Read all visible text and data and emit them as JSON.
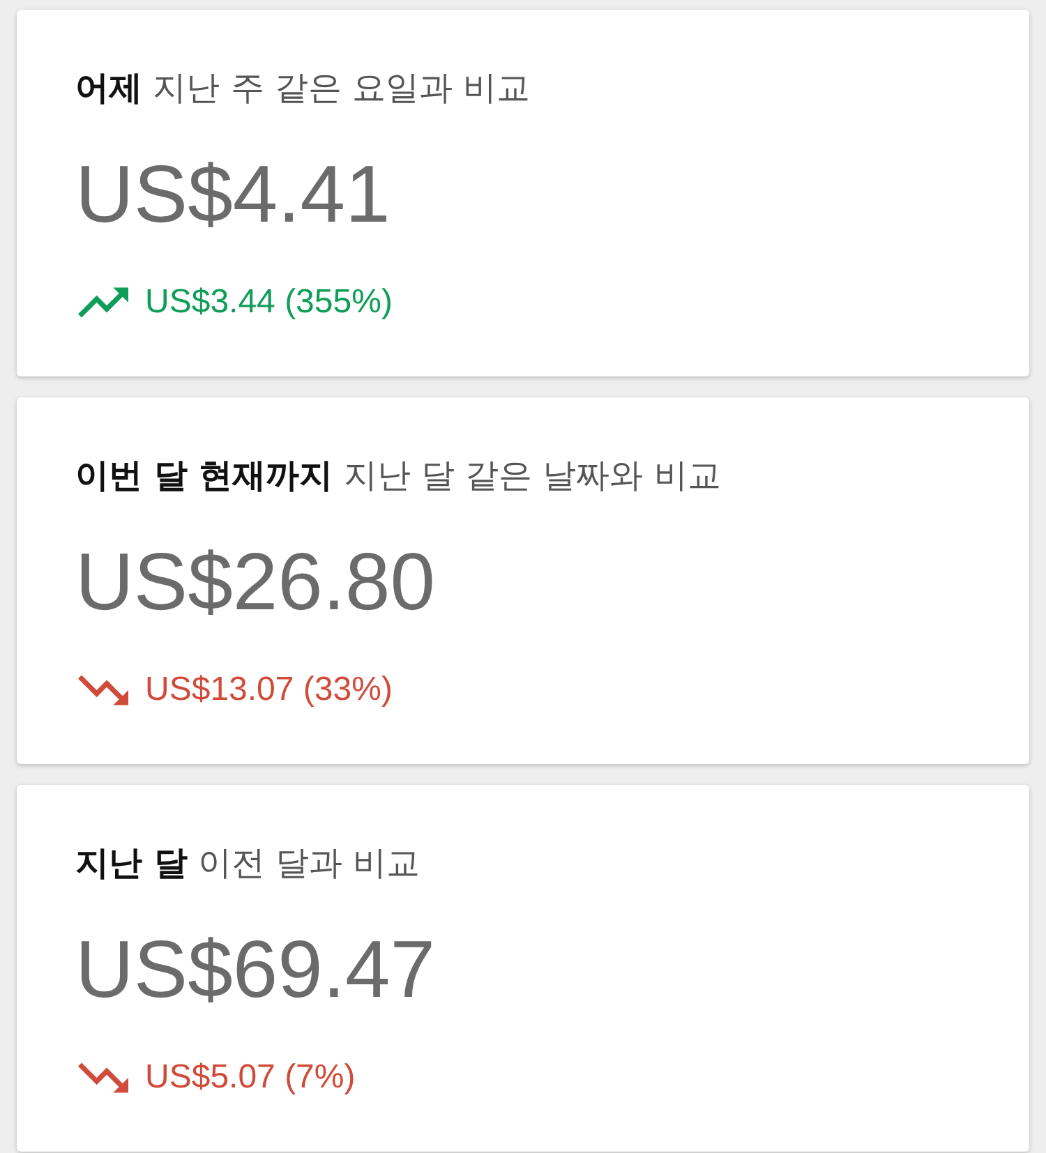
{
  "cards": [
    {
      "title": "**어제** 지난 주 같은 요일과 비교",
      "amount": "US$4.41",
      "change": {
        "kind": "up",
        "text": "US$3.44 (355%)"
      }
    },
    {
      "title": "**이번 달 현재까지** 지난 달 같은 날짜와 비교",
      "amount": "US$26.80",
      "change": {
        "kind": "down",
        "text": "US$13.07 (33%)"
      }
    },
    {
      "title": "**지난 달** 이전 달과 비교",
      "amount": "US$69.47",
      "change": {
        "kind": "down",
        "text": "US$5.07 (7%)"
      }
    }
  ]
}
